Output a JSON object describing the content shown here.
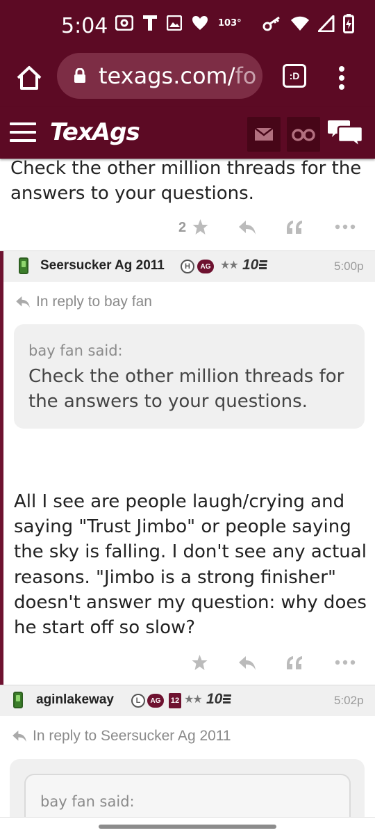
{
  "status_bar": {
    "time": "5:04",
    "temperature": "103°",
    "icons": [
      "radio-icon",
      "t-icon",
      "image-icon",
      "heart-icon",
      "key-icon",
      "wifi-icon",
      "signal-icon",
      "battery-charging-icon"
    ]
  },
  "browser": {
    "url_main": "texags.com/",
    "url_dim": "fo",
    "tab_label": ":D"
  },
  "site": {
    "logo": "TexAgs"
  },
  "top_post": {
    "text": "Check the other million threads for the answers to your questions.",
    "vote_count": "2"
  },
  "post1": {
    "username": "Seersucker Ag 2011",
    "badge_h": "H",
    "badge_ag": "AG",
    "stars": "★★",
    "ten": "10",
    "time": "5:00p",
    "reply_to": "In reply to bay fan",
    "quote_said": "bay fan said:",
    "quote_text": "Check the other million threads for the answers to your questions.",
    "body": "All I see are people laugh/crying and saying \"Trust Jimbo\" or people saying the sky is falling. I don't see any actual reasons. \"Jimbo is a strong finisher\" doesn't answer my question: why does he start off so slow?"
  },
  "post2": {
    "username": "aginlakeway",
    "badge_l": "L",
    "badge_ag": "AG",
    "badge_12": "12",
    "stars": "★★",
    "ten": "10",
    "time": "5:02p",
    "reply_to": "In reply to Seersucker Ag 2011",
    "quote_said": "bay fan said:"
  },
  "colors": {
    "maroon": "#5c0a24",
    "maroon_accent": "#6e1230",
    "icon_gray": "#bbbbbb"
  }
}
